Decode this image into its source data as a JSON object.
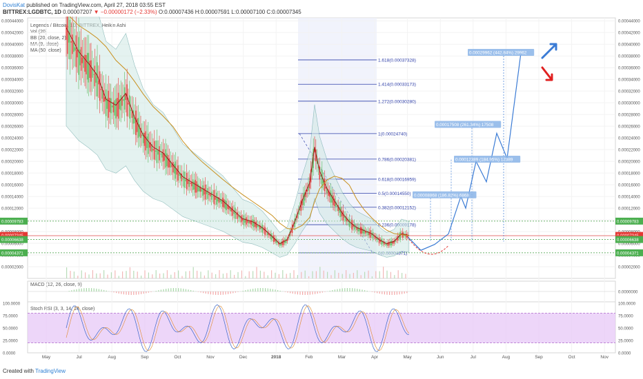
{
  "header": {
    "author": "DovisKat",
    "published": "published on TradingView.com, April 27, 2018 03:55 EST",
    "symbol": "BITTREX:LGDBTC, 1D",
    "price": "0.00007207",
    "change": "▼ −0.00000172 (−2.33%)",
    "ohlc": "O:0.00007436 H:0.00007591 L:0.00007100 C:0.00007345"
  },
  "legend": {
    "title": "Legends / Bitcoin, 1D, BITTREX, Heikin Ashi",
    "vol": "Vol (20)",
    "bb": "BB (20, close, 2)",
    "ma9": "MA (9, close)",
    "ma50": "MA (50, close)"
  },
  "macd_label": "MACD (12, 26, close, 9)",
  "stoch_label": "Stoch RSI (3, 3, 14, 14, close)",
  "footer": {
    "created": "Created with",
    "brand": "TradingView"
  },
  "colors": {
    "up": "#5cb85c",
    "down": "#e53935",
    "ma9": "#9e1b1b",
    "ma50": "#c8901e",
    "bb": "#3a8a8a",
    "fib": "#2f3fa8",
    "projection": "#3a7bd5",
    "stoch_fill": "#e7c8f7",
    "stoch_k": "#3a66c8"
  },
  "chart_data": [
    {
      "type": "line",
      "title": "Legends / Bitcoin, 1D, BITTREX, Heikin Ashi",
      "x_ticks": [
        "May",
        "Jul",
        "Aug",
        "Sep",
        "Oct",
        "Nov",
        "Dec",
        "2018",
        "Feb",
        "Mar",
        "Apr",
        "May",
        "Jun",
        "Jul",
        "Aug",
        "Sep",
        "Oct",
        "Nov"
      ],
      "y_ticks": [
        "0.00044000",
        "0.00042000",
        "0.00040000",
        "0.00038000",
        "0.00036000",
        "0.00034000",
        "0.00032000",
        "0.00030000",
        "0.00028000",
        "0.00026000",
        "0.00024000",
        "0.00022000",
        "0.00020000",
        "0.00018000",
        "0.00016000",
        "0.00014000",
        "0.00012000",
        "0.00010000",
        "0.00008000",
        "0.00006000",
        "0.00004000",
        "0.00002000"
      ],
      "ylim": [
        0,
        0.000445
      ],
      "price_tags": [
        {
          "value": 9.783e-05,
          "label": "0.00009783",
          "color": "#4caf50"
        },
        {
          "value": 7.345e-05,
          "label": "0.00007345",
          "color": "#e53935"
        },
        {
          "value": 7.207e-05,
          "label": "0.00007207",
          "color": "#e53935"
        },
        {
          "value": 6.638e-05,
          "label": "0.00006638",
          "color": "#4caf50"
        },
        {
          "value": 4.371e-05,
          "label": "0.00004371",
          "color": "#4caf50"
        }
      ],
      "fib_levels": [
        {
          "value": 0.00037328,
          "label": "1.618(0.00037328)"
        },
        {
          "value": 0.00033173,
          "label": "1.414(0.00033173)"
        },
        {
          "value": 0.0003028,
          "label": "1.272(0.00030280)"
        },
        {
          "value": 0.0002474,
          "label": "1(0.00024740)"
        },
        {
          "value": 0.00020381,
          "label": "0.786(0.00020381)"
        },
        {
          "value": 0.00016959,
          "label": "0.618(0.00016959)"
        },
        {
          "value": 0.0001455,
          "label": "0.5(0.00014550)"
        },
        {
          "value": 0.00012152,
          "label": "0.382(0.00012152)"
        },
        {
          "value": 9.178e-05,
          "label": "0.236(0.00009178)"
        },
        {
          "value": 4.371e-05,
          "label": "0(0.00004371)"
        }
      ],
      "projection_labels": [
        {
          "text": "0.00008868 (186.82%) 6868",
          "value": 0.0001415
        },
        {
          "text": "0.00012389 (184.95%) 12389",
          "value": 0.0002025
        },
        {
          "text": "0.00017508 (261.34%) 17508",
          "value": 0.000262
        },
        {
          "text": "0.00029962 (442.84%) 29962",
          "value": 0.000385
        }
      ],
      "price_series": [
        {
          "d": 0,
          "v": 0.00042
        },
        {
          "d": 5,
          "v": 0.0004
        },
        {
          "d": 10,
          "v": 0.00038
        },
        {
          "d": 18,
          "v": 0.00036
        },
        {
          "d": 25,
          "v": 0.00034
        },
        {
          "d": 32,
          "v": 0.0003
        },
        {
          "d": 40,
          "v": 0.00029
        },
        {
          "d": 48,
          "v": 0.00031
        },
        {
          "d": 55,
          "v": 0.00027
        },
        {
          "d": 62,
          "v": 0.00024
        },
        {
          "d": 70,
          "v": 0.00022
        },
        {
          "d": 78,
          "v": 0.00021
        },
        {
          "d": 86,
          "v": 0.00019
        },
        {
          "d": 94,
          "v": 0.00017
        },
        {
          "d": 102,
          "v": 0.00016
        },
        {
          "d": 110,
          "v": 0.00015
        },
        {
          "d": 118,
          "v": 0.00014
        },
        {
          "d": 126,
          "v": 0.00013
        },
        {
          "d": 134,
          "v": 0.000115
        },
        {
          "d": 142,
          "v": 0.0001
        },
        {
          "d": 150,
          "v": 9.5e-05
        },
        {
          "d": 158,
          "v": 8.5e-05
        },
        {
          "d": 166,
          "v": 7e-05
        },
        {
          "d": 172,
          "v": 5.8e-05
        },
        {
          "d": 178,
          "v": 6.5e-05
        },
        {
          "d": 184,
          "v": 9.5e-05
        },
        {
          "d": 190,
          "v": 0.00013
        },
        {
          "d": 196,
          "v": 0.00016
        },
        {
          "d": 200,
          "v": 0.00022
        },
        {
          "d": 204,
          "v": 0.00018
        },
        {
          "d": 210,
          "v": 0.00015
        },
        {
          "d": 216,
          "v": 0.00013
        },
        {
          "d": 222,
          "v": 0.00011
        },
        {
          "d": 228,
          "v": 9.5e-05
        },
        {
          "d": 234,
          "v": 8.5e-05
        },
        {
          "d": 240,
          "v": 8e-05
        },
        {
          "d": 246,
          "v": 7.5e-05
        },
        {
          "d": 252,
          "v": 6.5e-05
        },
        {
          "d": 258,
          "v": 5.8e-05
        },
        {
          "d": 264,
          "v": 6.2e-05
        },
        {
          "d": 270,
          "v": 7.5e-05
        },
        {
          "d": 276,
          "v": 7.2e-05
        }
      ]
    },
    {
      "type": "line",
      "title": "MACD (12, 26, close, 9)",
      "y_ticks": [
        "0.0000000"
      ],
      "ylim": [
        -4e-05,
        4e-05
      ]
    },
    {
      "type": "line",
      "title": "Stoch RSI (3, 3, 14, 14, close)",
      "y_ticks": [
        "100.0000",
        "75.0000",
        "50.0000",
        "25.0000",
        "0.0000"
      ],
      "ylim": [
        0,
        100
      ],
      "band": [
        20,
        80
      ]
    }
  ]
}
